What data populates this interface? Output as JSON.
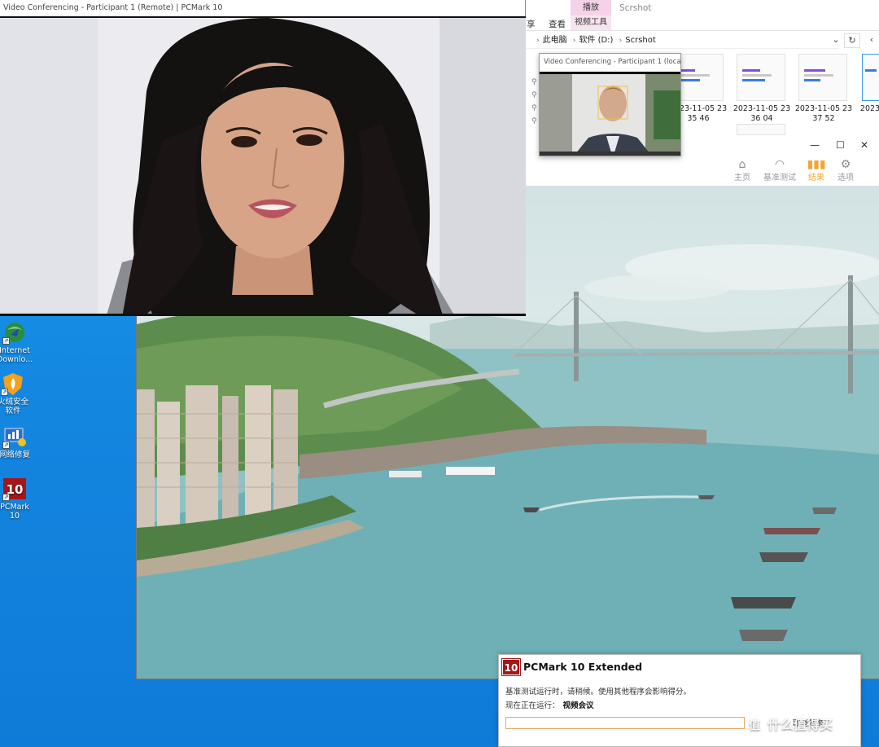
{
  "desktop": {
    "icons": [
      {
        "label": "Internet Downlo...",
        "icon": "idm-globe-icon"
      },
      {
        "label": "火绒安全软件",
        "icon": "huorong-shield-icon"
      },
      {
        "label": "网络修复",
        "icon": "network-repair-icon"
      },
      {
        "label": "PCMark 10",
        "icon": "pcmark-icon"
      }
    ]
  },
  "remote_window": {
    "title": "Video Conferencing - Participant 1 (Remote) | PCMark 10"
  },
  "local_window": {
    "title": "Video Conferencing - Participant 1 (local) |..."
  },
  "explorer": {
    "ribbon": {
      "share_tab": "享",
      "view_tab": "查看",
      "play_tab": "播放",
      "video_tools_tab": "视频工具",
      "folder_title": "Scrshot"
    },
    "breadcrumb": [
      "此电脑",
      "软件 (D:)",
      "Scrshot"
    ],
    "thumbnails": [
      {
        "label": "2023-11-05 23 35 46"
      },
      {
        "label": "2023-11-05 23 36 04"
      },
      {
        "label": "2023-11-05 23 37 52"
      },
      {
        "label": "2023"
      }
    ]
  },
  "pcmark": {
    "nav": [
      {
        "label": "主页",
        "icon": "home-icon",
        "active": false
      },
      {
        "label": "基准测试",
        "icon": "gauge-icon",
        "active": false
      },
      {
        "label": "结果",
        "icon": "bar-chart-icon",
        "active": true
      },
      {
        "label": "选项",
        "icon": "gear-icon",
        "active": false
      }
    ],
    "accent": "#f4a533"
  },
  "dialog": {
    "logo_text": "10",
    "title": "PCMark 10 Extended",
    "message": "基准测试运行时，请稍候。使用其他程序会影响得分。",
    "running_label": "现在正在运行：",
    "running_value": "视频会议",
    "progress": 0.0,
    "cancel_label": "取消基准"
  },
  "watermark": {
    "text": "什么值得买"
  }
}
